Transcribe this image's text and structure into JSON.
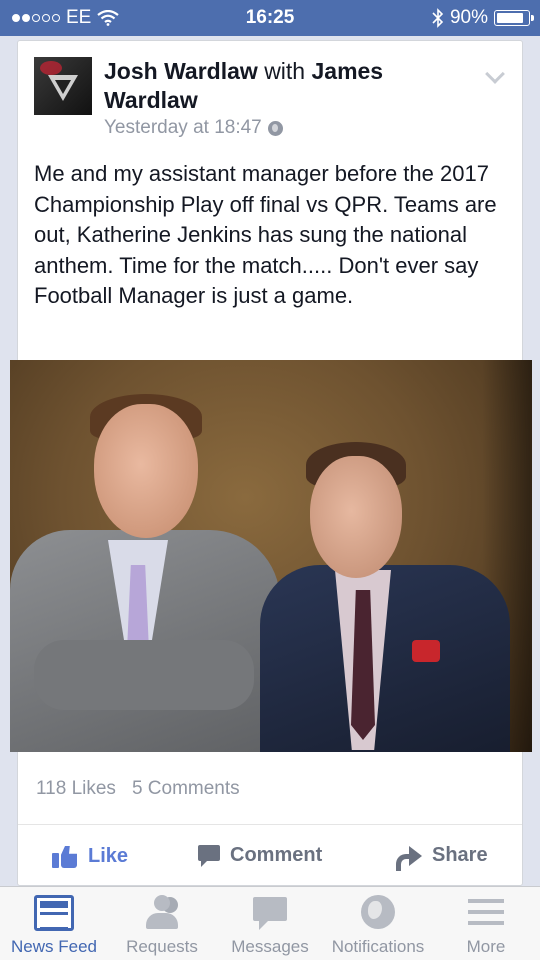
{
  "status_bar": {
    "carrier": "EE",
    "time": "16:25",
    "battery": "90%",
    "battery_level": 0.9,
    "signal_bars_filled": 2,
    "signal_bars_total": 5
  },
  "post": {
    "author": "Josh Wardlaw",
    "with_text": "with",
    "tagged": "James Wardlaw",
    "timestamp": "Yesterday at 18:47",
    "privacy_icon": "globe-icon",
    "text": "Me and my assistant manager before the 2017 Championship Play off final vs QPR. Teams are out, Katherine Jenkins has sung the national anthem. Time for the match..... Don't ever say Football Manager is just a game.",
    "likes": "118 Likes",
    "comments": "5 Comments",
    "actions": {
      "like": "Like",
      "comment": "Comment",
      "share": "Share"
    }
  },
  "tab_bar": {
    "tabs": [
      {
        "label": "News Feed",
        "icon": "news-feed-icon",
        "active": true
      },
      {
        "label": "Requests",
        "icon": "friend-requests-icon",
        "active": false
      },
      {
        "label": "Messages",
        "icon": "messages-icon",
        "active": false
      },
      {
        "label": "Notifications",
        "icon": "notifications-icon",
        "active": false
      },
      {
        "label": "More",
        "icon": "menu-icon",
        "active": false
      }
    ]
  },
  "colors": {
    "status_bar_bg": "#4d6eae",
    "accent": "#4267b2",
    "like_blue": "#5b7bd5",
    "muted_text": "#9197a3"
  }
}
